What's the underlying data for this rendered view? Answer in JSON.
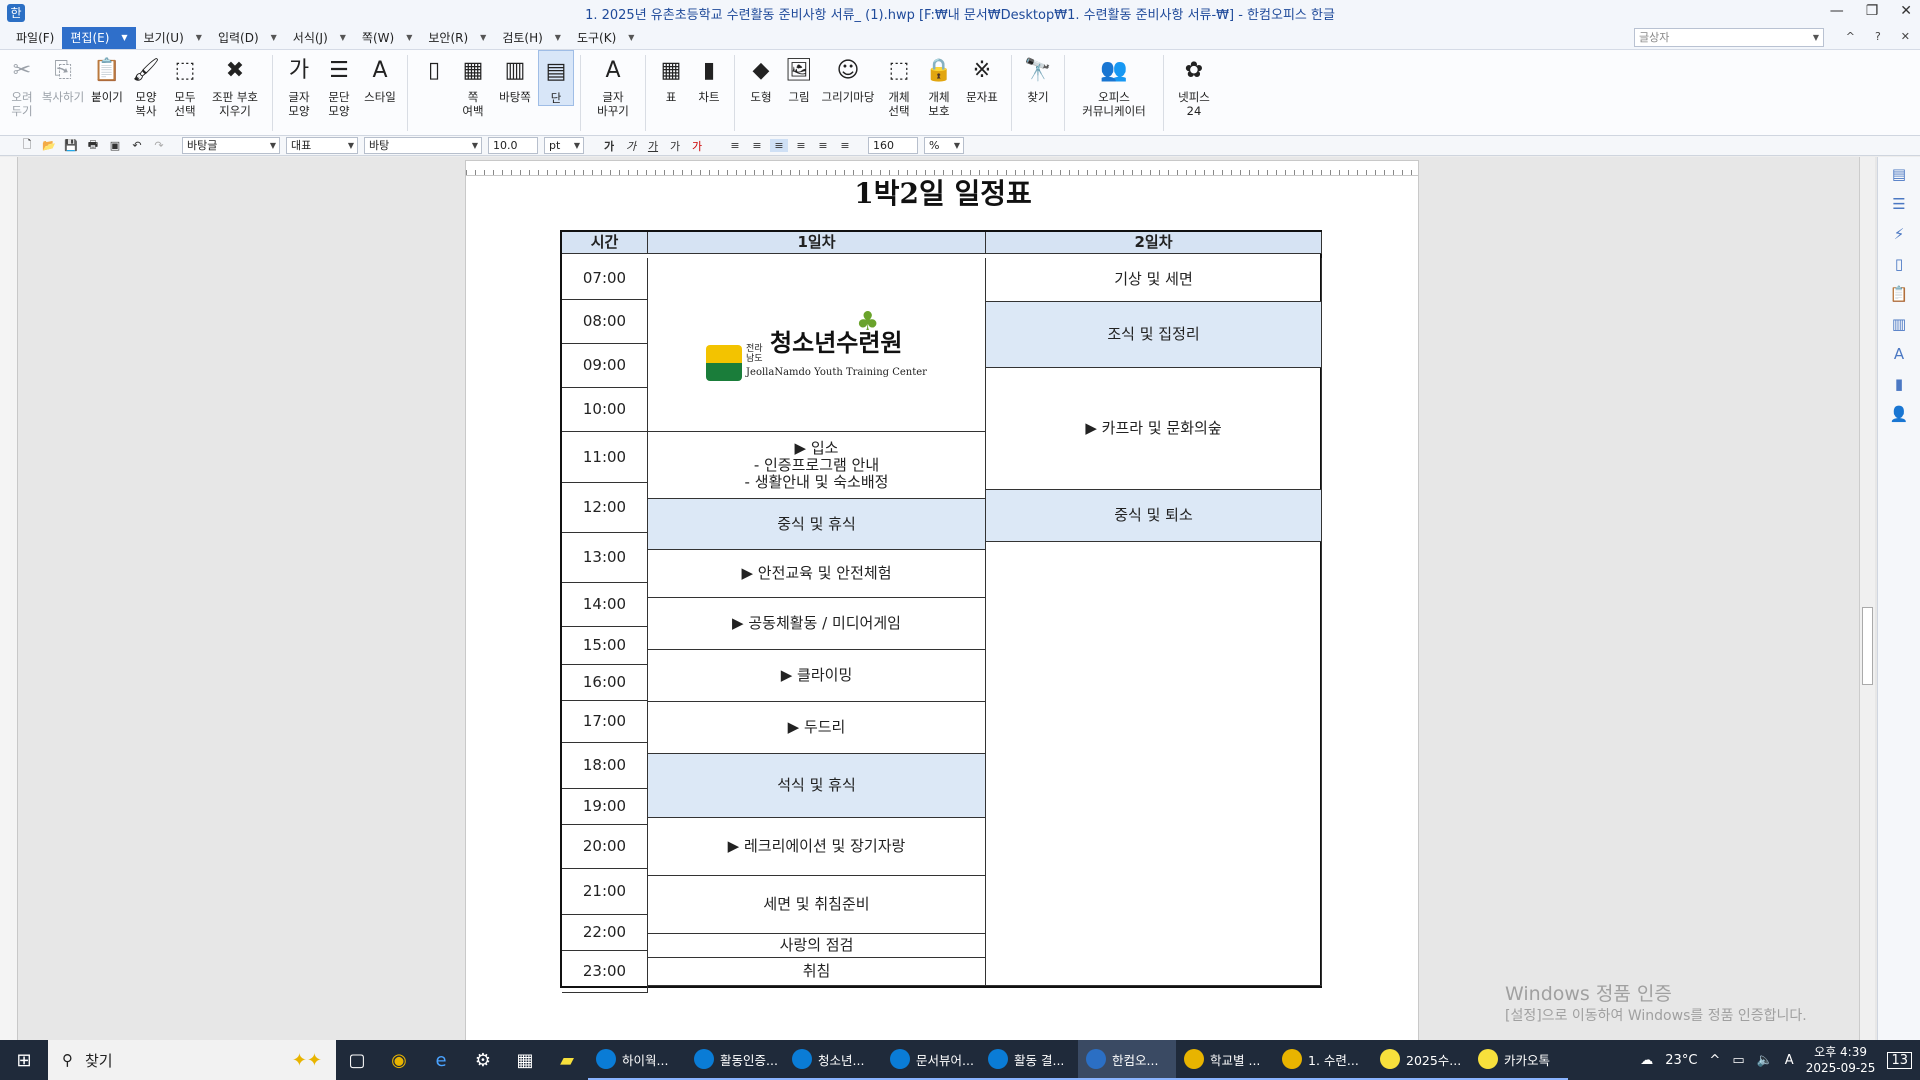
{
  "window": {
    "title": "1. 2025년 유촌초등학교 수련활동 준비사항 서류_ (1).hwp [F:₩내 문서₩Desktop₩1. 수련활동 준비사항 서류-₩] - 한컴오피스 한글"
  },
  "menu": {
    "items": [
      "파일(F)",
      "편집(E)",
      "보기(U)",
      "입력(D)",
      "서식(J)",
      "쪽(W)",
      "보안(R)",
      "검토(H)",
      "도구(K)"
    ],
    "style_box_placeholder": "글상자"
  },
  "ribbon": {
    "buttons": [
      {
        "label": "오려\n두기",
        "icon": "scissors-icon",
        "glyph": "✂",
        "disabled": true
      },
      {
        "label": "복사하기",
        "icon": "copy-icon",
        "glyph": "⎘",
        "disabled": true
      },
      {
        "label": "붙이기",
        "icon": "paste-icon",
        "glyph": "📋",
        "disabled": false
      },
      {
        "label": "모양\n복사",
        "icon": "format-painter-icon",
        "glyph": "🖌",
        "disabled": false
      },
      {
        "label": "모두\n선택",
        "icon": "select-all-icon",
        "glyph": "⬚",
        "disabled": false
      },
      {
        "label": "조판 부호\n지우기",
        "icon": "clear-format-icon",
        "glyph": "✖",
        "disabled": false
      },
      {
        "label": "글자\n모양",
        "icon": "char-shape-icon",
        "glyph": "가",
        "disabled": false
      },
      {
        "label": "문단\n모양",
        "icon": "paragraph-icon",
        "glyph": "☰",
        "disabled": false
      },
      {
        "label": "스타일",
        "icon": "style-icon",
        "glyph": "A",
        "disabled": false
      },
      {
        "label": "",
        "icon": "page-icon",
        "glyph": "▯",
        "disabled": false
      },
      {
        "label": "쪽\n여백",
        "icon": "margin-icon",
        "glyph": "▦",
        "disabled": false
      },
      {
        "label": "바탕쪽",
        "icon": "master-page-icon",
        "glyph": "▥",
        "disabled": false
      },
      {
        "label": "단",
        "icon": "columns-icon",
        "glyph": "▤",
        "disabled": false
      },
      {
        "label": "글자\n바꾸기",
        "icon": "replace-char-icon",
        "glyph": "A",
        "disabled": false
      },
      {
        "label": "표",
        "icon": "table-icon",
        "glyph": "▦",
        "disabled": false
      },
      {
        "label": "차트",
        "icon": "chart-icon",
        "glyph": "▮",
        "disabled": false
      },
      {
        "label": "도형",
        "icon": "shape-icon",
        "glyph": "◆",
        "disabled": false
      },
      {
        "label": "그림",
        "icon": "picture-icon",
        "glyph": "🖼",
        "disabled": false
      },
      {
        "label": "그리기마당",
        "icon": "clipart-icon",
        "glyph": "☺",
        "disabled": false
      },
      {
        "label": "개체\n선택",
        "icon": "object-select-icon",
        "glyph": "⬚",
        "disabled": false
      },
      {
        "label": "개체\n보호",
        "icon": "object-protect-icon",
        "glyph": "🔒",
        "disabled": false
      },
      {
        "label": "문자표",
        "icon": "symbol-icon",
        "glyph": "※",
        "disabled": false
      },
      {
        "label": "찾기",
        "icon": "find-icon",
        "glyph": "🔭",
        "disabled": false
      },
      {
        "label": "오피스\n커뮤니케이터",
        "icon": "communicator-icon",
        "glyph": "👥",
        "disabled": false
      },
      {
        "label": "넷피스\n24",
        "icon": "netffice-icon",
        "glyph": "✿",
        "disabled": false
      }
    ]
  },
  "format_bar": {
    "style": "바탕글",
    "representative": "대표",
    "font": "바탕",
    "size": "10.0",
    "size_unit": "pt",
    "zoom": "160",
    "zoom_unit": "%"
  },
  "document": {
    "title": "1박2일 일정표",
    "headers": {
      "time": "시간",
      "day1": "1일차",
      "day2": "2일차"
    },
    "times": [
      "07:00",
      "08:00",
      "09:00",
      "10:00",
      "11:00",
      "12:00",
      "13:00",
      "14:00",
      "15:00",
      "16:00",
      "17:00",
      "18:00",
      "19:00",
      "20:00",
      "21:00",
      "22:00",
      "23:00"
    ],
    "logo": {
      "line1": "전라남도",
      "main": "청소년수련원",
      "sub": "JeollaNamdo Youth Training Center"
    },
    "day1": [
      "▶ 입소\n - 인증프로그램 안내\n - 생활안내 및 숙소배정",
      "중식 및 휴식",
      "▶ 안전교육 및 안전체험",
      "▶ 공동체활동 / 미디어게임",
      "▶ 클라이밍",
      "▶ 두드리",
      "석식 및 휴식",
      "▶ 레크리에이션 및 장기자랑",
      "세면 및 취침준비",
      "사랑의 점검",
      "취침"
    ],
    "day2": [
      "기상 및 세면",
      "조식 및 집정리",
      "▶ 카프라 및 문화의숲",
      "중식 및 퇴소"
    ]
  },
  "watermark": {
    "line1": "Windows 정품 인증",
    "line2": "[설정]으로 이동하여 Windows를 정품 인증합니다."
  },
  "taskbar": {
    "search_label": "찾기",
    "apps": [
      {
        "label": "하이웍...",
        "color": "#0a7cd6"
      },
      {
        "label": "활동인증...",
        "color": "#0a7cd6"
      },
      {
        "label": "청소년...",
        "color": "#0a7cd6"
      },
      {
        "label": "문서뷰어...",
        "color": "#0a7cd6"
      },
      {
        "label": "활동 결...",
        "color": "#0a7cd6"
      },
      {
        "label": "한컴오...",
        "color": "#2b6fc4"
      },
      {
        "label": "학교별 ...",
        "color": "#e8b400"
      },
      {
        "label": "1. 수련...",
        "color": "#e8b400"
      },
      {
        "label": "2025수...",
        "color": "#f7e03c"
      },
      {
        "label": "카카오톡",
        "color": "#f7e03c"
      }
    ],
    "weather": "23°C",
    "ime": "A",
    "time": "오후 4:39",
    "date": "2025-09-25",
    "notifications": "13"
  }
}
